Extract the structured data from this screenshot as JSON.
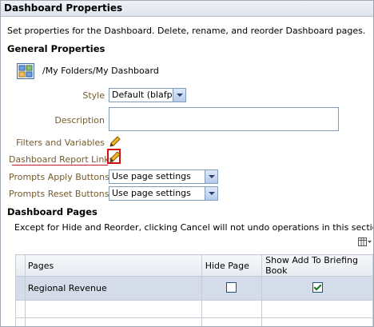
{
  "window": {
    "title": "Dashboard Properties"
  },
  "intro_text": "Set properties for the Dashboard. Delete, rename, and reorder Dashboard pages.",
  "general": {
    "heading": "General Properties",
    "path": "/My Folders/My Dashboard",
    "style_label": "Style",
    "style_value": "Default (blafp)",
    "description_label": "Description",
    "description_value": "",
    "filters_label": "Filters and Variables",
    "report_links_label": "Dashboard Report Links",
    "prompts_apply_label": "Prompts Apply Buttons",
    "prompts_apply_value": "Use page settings",
    "prompts_reset_label": "Prompts Reset Buttons",
    "prompts_reset_value": "Use page settings"
  },
  "pages_section": {
    "heading": "Dashboard Pages",
    "note": "Except for Hide and Reorder, clicking Cancel will not undo operations in this section.",
    "columns": [
      "Pages",
      "Hide Page",
      "Show Add To Briefing Book"
    ],
    "rows": [
      {
        "page": "Regional Revenue",
        "hide": false,
        "briefing": true
      }
    ]
  },
  "colors": {
    "label_brown": "#755a2a",
    "highlight_red": "#d01010",
    "selected_row": "#d4dbe9"
  },
  "icons": [
    "dashboard-icon",
    "pencil-icon",
    "column-settings-icon",
    "dropdown-arrow-icon"
  ]
}
